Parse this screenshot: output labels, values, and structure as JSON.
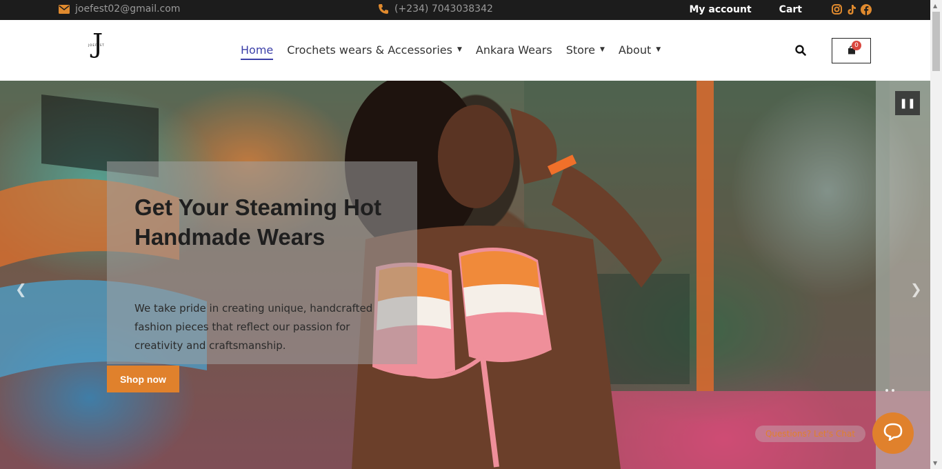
{
  "topbar": {
    "email": "joefest02@gmail.com",
    "phone": "(+234) 7043038342",
    "my_account": "My account",
    "cart": "Cart",
    "social_icons": [
      "instagram-icon",
      "tiktok-icon",
      "facebook-icon"
    ]
  },
  "header": {
    "logo_letter": "J",
    "logo_text": "JOEFEST",
    "nav": [
      {
        "label": "Home",
        "active": true
      },
      {
        "label": "Crochets wears & Accessories",
        "has_dropdown": true
      },
      {
        "label": "Ankara Wears"
      },
      {
        "label": "Store",
        "has_dropdown": true
      },
      {
        "label": "About",
        "has_dropdown": true
      }
    ],
    "cart_count": "0"
  },
  "hero": {
    "title": "Get Your Steaming Hot Handmade Wears",
    "text": "We take pride in creating unique, handcrafted fashion pieces that reflect our passion for creativity and craftsmanship.",
    "button": "Shop now"
  },
  "chat": {
    "prompt": "Questions? Let's Chat"
  },
  "colors": {
    "accent": "#e0812c",
    "nav_active": "#3b3fa8",
    "topbar_bg": "#1c1c1c",
    "badge": "#d9473f"
  }
}
